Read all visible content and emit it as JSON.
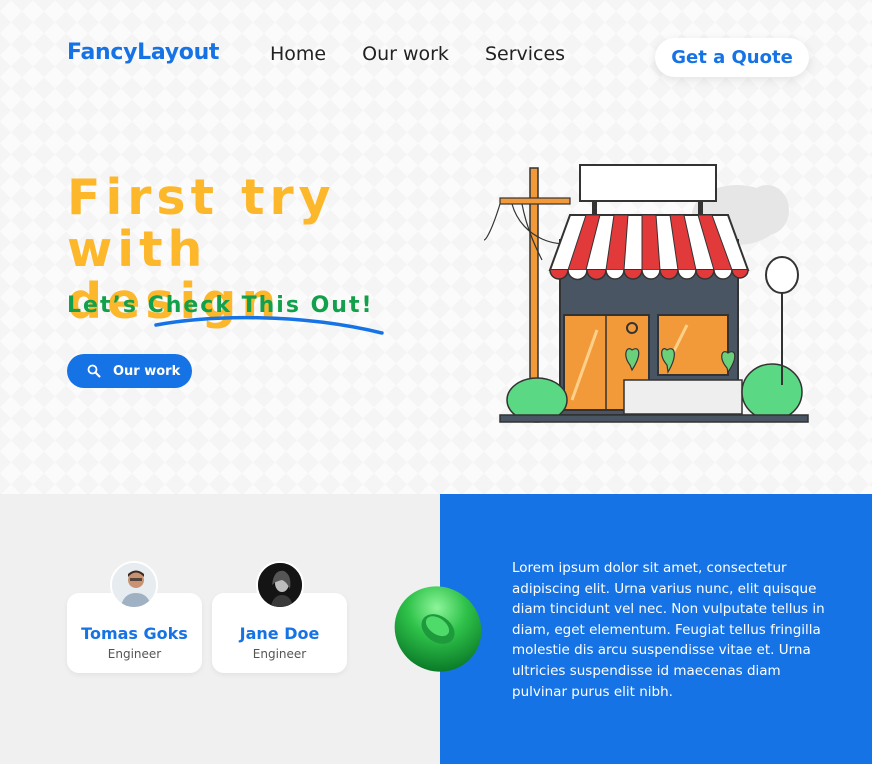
{
  "header": {
    "logo": "FancyLayout",
    "nav": [
      "Home",
      "Our work",
      "Services"
    ],
    "cta_label": "Get a Quote"
  },
  "hero": {
    "headline_line1": "First try with",
    "headline_line2": "design",
    "subline": "Let’s Check This Out!",
    "button_label": "Our work",
    "illustration": "storefront-illustration"
  },
  "team": [
    {
      "name": "Tomas Goks",
      "role": "Engineer"
    },
    {
      "name": "Jane Doe",
      "role": "Engineer"
    }
  ],
  "about": {
    "text": "Lorem ipsum dolor sit amet, consectetur adipiscing elit. Urna varius nunc, elit quisque diam tincidunt vel nec. Non vulputate tellus in diam, eget elementum. Feugiat tellus fringilla molestie dis arcu suspendisse vitae et. Urna ultricies suspendisse id maecenas diam pulvinar purus elit nibh."
  },
  "colors": {
    "primary": "#1673e6",
    "accent_yellow": "#fcb72a",
    "accent_green": "#12a04a",
    "panel_grey": "#f0f0f0"
  }
}
